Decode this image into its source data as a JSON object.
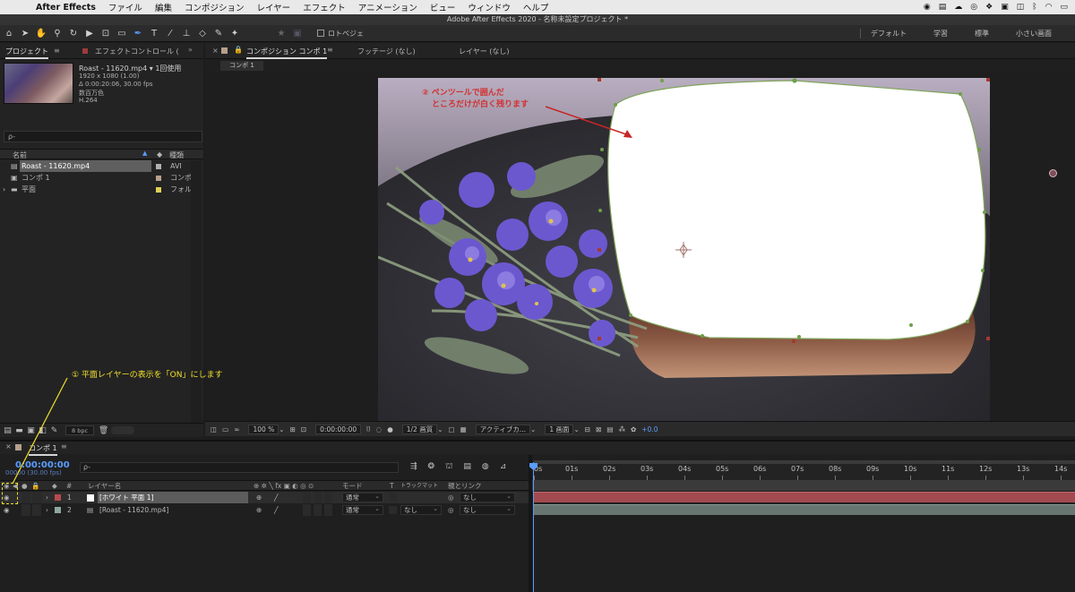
{
  "menubar": {
    "app_name": "After Effects",
    "items": [
      "ファイル",
      "編集",
      "コンポジション",
      "レイヤー",
      "エフェクト",
      "アニメーション",
      "ビュー",
      "ウィンドウ",
      "ヘルプ"
    ]
  },
  "window": {
    "title": "Adobe After Effects 2020 - 名称未設定プロジェクト *"
  },
  "toolbar": {
    "rotobrush_label": "ロトベジェ",
    "workspaces": [
      "デフォルト",
      "学習",
      "標準",
      "小さい画面"
    ]
  },
  "project_panel": {
    "tabs": [
      "プロジェクト",
      "エフェクトコントロール ("
    ],
    "selected_item": {
      "name": "Roast - 11620.mp4",
      "usage": "1回使用",
      "info": [
        "1920 x 1080 (1.00)",
        "Δ 0:00:20:06, 30.00 fps",
        "数百万色",
        "H.264"
      ]
    },
    "search_placeholder": "ρ-",
    "columns": {
      "name": "名前",
      "type": "種類"
    },
    "items": [
      {
        "name": "Roast - 11620.mp4",
        "type": "AVI",
        "color": "#b0b0b0"
      },
      {
        "name": "コンポ 1",
        "type": "コンポシ",
        "color": "#b6a08c"
      },
      {
        "name": "平面",
        "type": "フォルタ",
        "color": "#e0cf5a"
      }
    ],
    "bpc": "8 bpc"
  },
  "comp_panel": {
    "tabs": [
      "コンポジション コンポ 1",
      "フッテージ (なし)",
      "レイヤー (なし)"
    ],
    "breadcrumb": "コンポ 1",
    "viewer_bar": {
      "zoom": "100 %",
      "timecode": "0:00:00:00",
      "resolution": "1/2 画質",
      "camera": "アクティブカ...",
      "view": "1 画面",
      "exposure": "+0.0"
    }
  },
  "annotations": {
    "pen_note_line1": "② ペンツールで囲んだ",
    "pen_note_line2": "ところだけが白く残ります",
    "layer_note": "① 平面レイヤーの表示を「ON」にします"
  },
  "timeline": {
    "tab_label": "コンポ 1",
    "timecode": "0:00:00:00",
    "fps_info": "00000 (30.00 fps)",
    "search_placeholder": "ρ-",
    "columns": {
      "num": "#",
      "layer_name": "レイヤー名",
      "mode": "モード",
      "t": "T",
      "track_matte": "トラックマット",
      "parent": "親とリンク"
    },
    "layers": [
      {
        "num": "1",
        "name": "[ホワイト 平面 1]",
        "mode": "通常",
        "matte": "",
        "parent": "なし",
        "color": "#b64a4e"
      },
      {
        "num": "2",
        "name": "[Roast - 11620.mp4]",
        "mode": "通常",
        "matte": "なし",
        "parent": "なし",
        "color": "#8fa7a0"
      }
    ],
    "ruler": [
      "0s",
      "01s",
      "02s",
      "03s",
      "04s",
      "05s",
      "06s",
      "07s",
      "08s",
      "09s",
      "10s",
      "11s",
      "12s",
      "13s",
      "14s"
    ]
  }
}
